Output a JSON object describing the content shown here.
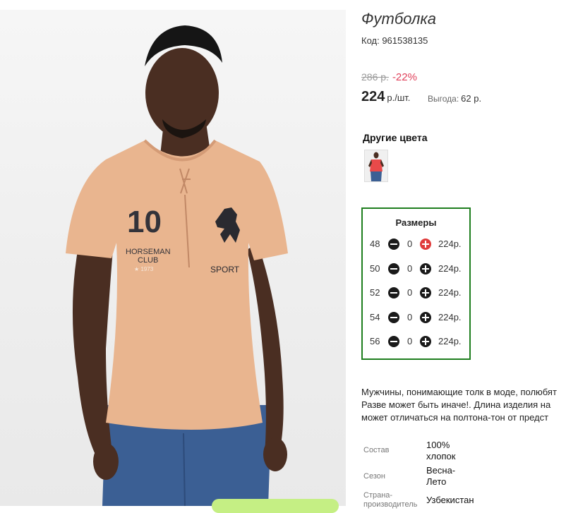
{
  "product": {
    "title": "Футболка",
    "code": "Код: 961538135",
    "old_price": "286 р.",
    "discount": "-22%",
    "price": "224",
    "price_unit": "р./шт.",
    "benefit_label": "Выгода:",
    "benefit_value": "62 р.",
    "colors_title": "Другие цвета",
    "color_swatch": {
      "name": "red-shirt-thumbnail",
      "color": "#e84a4a"
    },
    "shirt_print": {
      "number": "10",
      "line1": "HORSEMAN",
      "line2": "CLUB",
      "line3": "★ 1973",
      "sport": "SPORT"
    }
  },
  "sizes": {
    "title": "Размеры",
    "rows": [
      {
        "size": "48",
        "qty": "0",
        "price": "224р.",
        "plus_active": true
      },
      {
        "size": "50",
        "qty": "0",
        "price": "224р.",
        "plus_active": false
      },
      {
        "size": "52",
        "qty": "0",
        "price": "224р.",
        "plus_active": false
      },
      {
        "size": "54",
        "qty": "0",
        "price": "224р.",
        "plus_active": false
      },
      {
        "size": "56",
        "qty": "0",
        "price": "224р.",
        "plus_active": false
      }
    ]
  },
  "description": {
    "lines": [
      "Мужчины, понимающие толк в моде, полюбят",
      "Разве может быть иначе!. Длина изделия на",
      "может отличаться на полтона-тон от предст"
    ]
  },
  "attributes": [
    {
      "label": [
        "Состав"
      ],
      "value": [
        "100%",
        "хлопок"
      ]
    },
    {
      "label": [
        "Сезон"
      ],
      "value": [
        "Весна-",
        "Лето"
      ]
    },
    {
      "label": [
        "Страна-",
        "производитель"
      ],
      "value": [
        "Узбекистан"
      ]
    }
  ],
  "colors": {
    "border_green": "#1e7e1e",
    "discount_red": "#e0405a",
    "active_plus": "#e03c3c",
    "buy_button": "#c5ef84"
  }
}
